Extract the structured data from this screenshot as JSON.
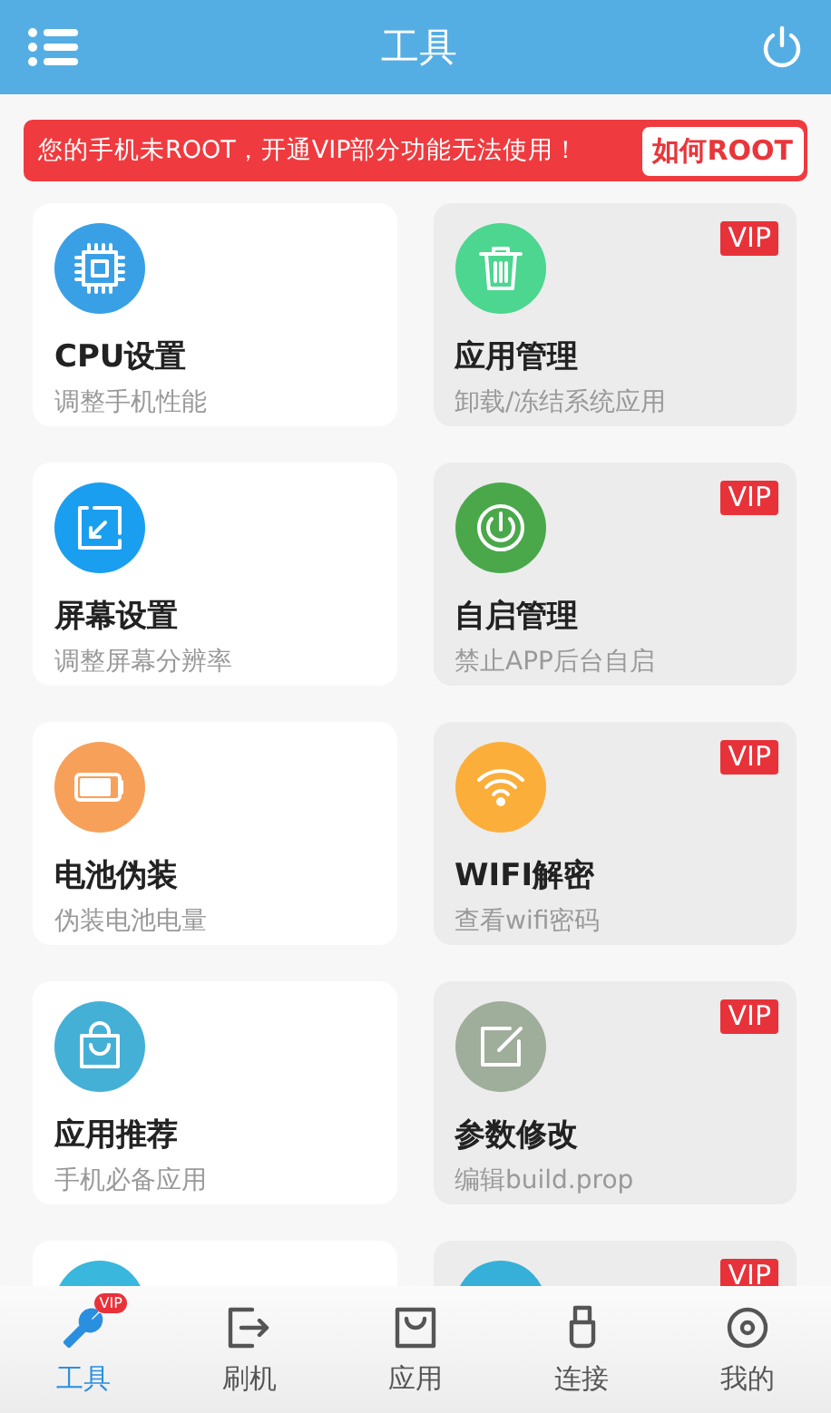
{
  "header": {
    "title": "工具"
  },
  "banner": {
    "message": "您的手机未ROOT，开通VIP部分功能无法使用！",
    "button": "如何ROOT"
  },
  "tools": [
    {
      "title": "CPU设置",
      "subtitle": "调整手机性能",
      "color": "#3aa0e6"
    },
    {
      "title": "应用管理",
      "subtitle": "卸载/冻结系统应用",
      "badge": "VIP",
      "color": "#4cd68f"
    },
    {
      "title": "屏幕设置",
      "subtitle": "调整屏幕分辨率",
      "color": "#1a9ef0"
    },
    {
      "title": "自启管理",
      "subtitle": "禁止APP后台自启",
      "badge": "VIP",
      "color": "#4aa84b"
    },
    {
      "title": "电池伪装",
      "subtitle": "伪装电池电量",
      "color": "#f7a05a"
    },
    {
      "title": "WIFI解密",
      "subtitle": "查看wifi密码",
      "badge": "VIP",
      "color": "#fcae3a"
    },
    {
      "title": "应用推荐",
      "subtitle": "手机必备应用",
      "color": "#45b0d6"
    },
    {
      "title": "参数修改",
      "subtitle": "编辑build.prop",
      "badge": "VIP",
      "color": "#9fad9b"
    },
    {
      "color": "#3ab7dc"
    },
    {
      "badge": "VIP",
      "color": "#36b0d8"
    }
  ],
  "nav": [
    {
      "label": "工具",
      "selected": true,
      "badge": "VIP"
    },
    {
      "label": "刷机",
      "selected": false
    },
    {
      "label": "应用",
      "selected": false
    },
    {
      "label": "连接",
      "selected": false
    },
    {
      "label": "我的",
      "selected": false
    }
  ]
}
